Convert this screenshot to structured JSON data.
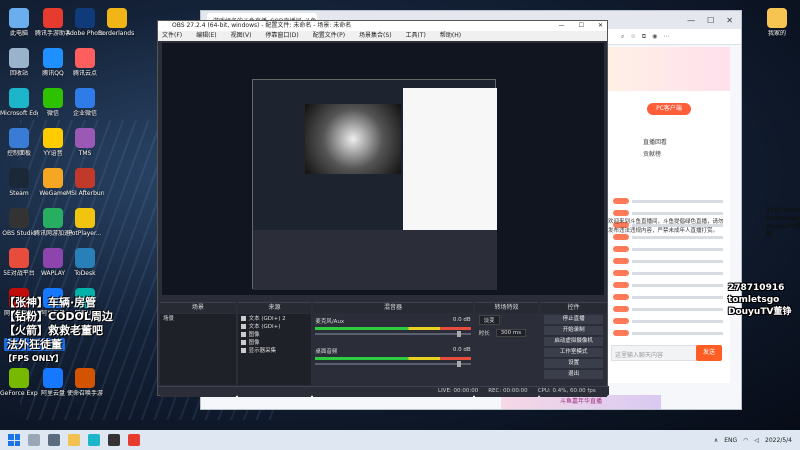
{
  "desktop": {
    "icons": [
      {
        "label": "此电脑",
        "color": "#6aaef0"
      },
      {
        "label": "腾讯手游助手",
        "color": "#e63b2e"
      },
      {
        "label": "Adobe Photosh...",
        "color": "#0f3b7a"
      },
      {
        "label": "Borderlands 3",
        "color": "#f2b517"
      },
      {
        "label": "回收站",
        "color": "#9ab3cc"
      },
      {
        "label": "腾讯QQ",
        "color": "#1e90ff"
      },
      {
        "label": "腾讯云点",
        "color": "#ff5e5e"
      },
      {
        "label": "Microsoft Edge",
        "color": "#1cb5c9"
      },
      {
        "label": "微信",
        "color": "#2dc100"
      },
      {
        "label": "企业微信",
        "color": "#2f7be8"
      },
      {
        "label": "控制面板",
        "color": "#3a7bd5"
      },
      {
        "label": "YY语音",
        "color": "#ffcc00"
      },
      {
        "label": "TMS",
        "color": "#9b59b6"
      },
      {
        "label": "Steam",
        "color": "#1b2838"
      },
      {
        "label": "WeGame",
        "color": "#f5a623"
      },
      {
        "label": "MSI Afterburner",
        "color": "#c0392b"
      },
      {
        "label": "OBS Studio",
        "color": "#333333"
      },
      {
        "label": "腾讯网游加速器5.0",
        "color": "#27ae60"
      },
      {
        "label": "PotPlayer...",
        "color": "#f1c40f"
      },
      {
        "label": "5E对战平台",
        "color": "#e74c3c"
      },
      {
        "label": "WAPLAY",
        "color": "#8e44ad"
      },
      {
        "label": "ToDesk",
        "color": "#2980b9"
      },
      {
        "label": "网易云音乐",
        "color": "#c20c0c"
      },
      {
        "label": "阿里云盘",
        "color": "#1677ff"
      },
      {
        "label": "网易UU",
        "color": "#00b2a9"
      },
      {
        "label": "GeForce Experience",
        "color": "#76b900"
      },
      {
        "label": "阿里云盘",
        "color": "#1677ff"
      },
      {
        "label": "使命召唤手游",
        "color": "#d35400"
      }
    ],
    "right_icon": {
      "label": "我家的",
      "color": "#f5c451"
    },
    "overlay_lines": [
      "【张神】车辆·房管",
      "【钻粉】CODOL周边",
      "【火箭】救救老董吧"
    ],
    "overlay_highlight": "法外狂徒董",
    "overlay_fps": "【FPS ONLY】",
    "right_overlay": [
      "278710916",
      "tomletsgo",
      "DouyuTV董铮"
    ]
  },
  "browser": {
    "tab_title": "游戏组名的斗鱼直播_COD直播间_斗鱼",
    "pc_client_btn": "PC客户端",
    "chat_tabs": [
      "直播回看",
      "贡献榜"
    ],
    "mid_overlay": [
      "278710916",
      "tomletsgo",
      "DouyuTV董铮"
    ],
    "mid_text": "欢迎来到斗鱼直播间，斗鱼提倡绿色直播，请勿发布违法违规内容，严禁未成年人直播打赏。",
    "chat_placeholder": "这里输入聊天内容",
    "send_label": "发送",
    "bottom_banner": "斗鱼嘉年华直播"
  },
  "obs": {
    "title": "OBS 27.2.4 (64-bit, windows) - 配置文件: 未命名 - 场景: 未命名",
    "menu": [
      "文件(F)",
      "编辑(E)",
      "视图(V)",
      "停靠窗口(D)",
      "配置文件(P)",
      "场景集合(S)",
      "工具(T)",
      "帮助(H)"
    ],
    "panels": {
      "scenes_title": "场景",
      "scene_item": "场景",
      "sources_title": "来源",
      "sources": [
        "文本 (GDI+) 2",
        "文本 (GDI+)",
        "图像",
        "图像",
        "显示器采集"
      ],
      "mixer_title": "混音器",
      "mixer_channels": [
        {
          "name": "麦克风/Aux",
          "value": "0.0 dB"
        },
        {
          "name": "桌面音频",
          "value": "0.0 dB"
        }
      ],
      "transitions_title": "转场特效",
      "transition_type": "淡变",
      "duration_label": "时长",
      "duration_value": "300 ms",
      "controls_title": "控件",
      "controls": [
        "停止直播",
        "开始录制",
        "启动虚拟摄像机",
        "工作室模式",
        "设置",
        "退出"
      ]
    },
    "status": {
      "live": "LIVE: 00:00:00",
      "rec": "REC: 00:00:00",
      "cpu": "CPU: 0.4%, 60.00 fps"
    },
    "dock_title": "来源选择"
  },
  "taskbar": {
    "tray_lang": "ENG",
    "time": "2022/5/4"
  }
}
